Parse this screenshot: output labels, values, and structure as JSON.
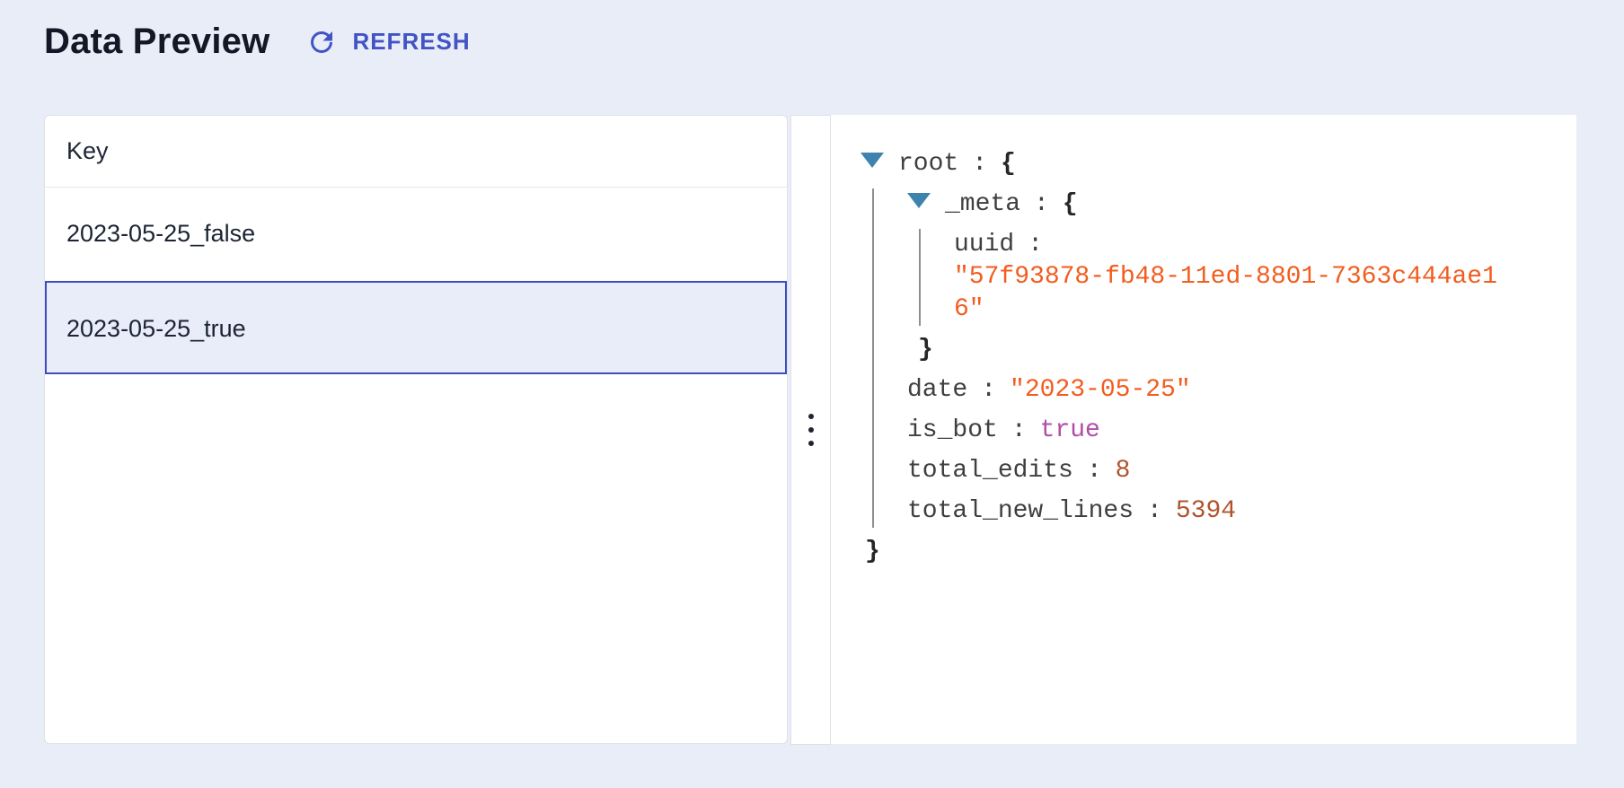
{
  "header": {
    "title": "Data Preview",
    "refresh_label": "REFRESH",
    "refresh_icon": "refresh-circular-arrow-icon"
  },
  "table": {
    "key_header": "Key",
    "rows": [
      {
        "key": "2023-05-25_false",
        "selected": false
      },
      {
        "key": "2023-05-25_true",
        "selected": true
      }
    ]
  },
  "splitter": {
    "handle_icon": "vertical-ellipsis-drag-handle"
  },
  "json_viewer": {
    "punct": {
      "colon": ":",
      "open": "{",
      "close": "}"
    },
    "root": {
      "key": "root"
    },
    "meta": {
      "key": "_meta"
    },
    "uuid": {
      "key": "uuid",
      "value": "\"57f93878-fb48-11ed-8801-7363c444ae16\"",
      "type": "string"
    },
    "date": {
      "key": "date",
      "value": "\"2023-05-25\"",
      "type": "string"
    },
    "is_bot": {
      "key": "is_bot",
      "value": "true",
      "type": "boolean"
    },
    "total_edits": {
      "key": "total_edits",
      "value": "8",
      "type": "number"
    },
    "total_new_lines": {
      "key": "total_new_lines",
      "value": "5394",
      "type": "number"
    }
  },
  "colors": {
    "page_background": "#E9EDF8",
    "panel_background": "#FFFFFF",
    "panel_border": "#DFE1E6",
    "accent_indigo": "#4254C5",
    "selected_row_border": "#3D4EC2",
    "selected_row_background": "#E9EDFA",
    "tree_triangle": "#3E82AE",
    "tree_guide_line": "#8F8F8F",
    "tree_key": "#3F3F3F",
    "tree_string": "#F25C1F",
    "tree_boolean": "#B14DA9",
    "tree_number": "#B0532C",
    "title_text": "#121826",
    "table_text": "#1B2433"
  }
}
